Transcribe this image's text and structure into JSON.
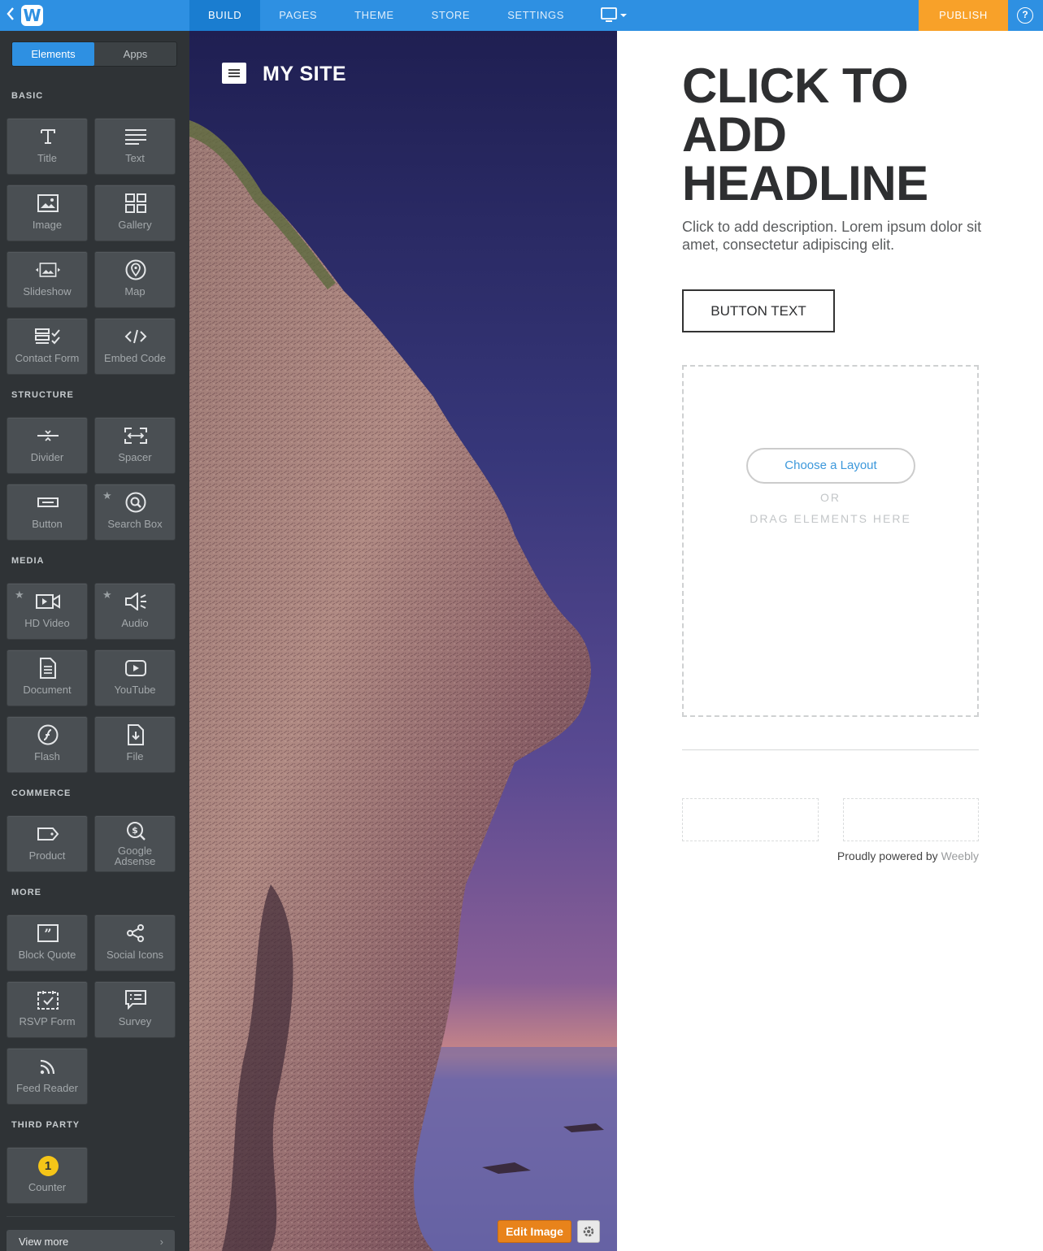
{
  "topbar": {
    "back_icon": "chevron-left-icon",
    "logo_letter": "W",
    "tabs": [
      "BUILD",
      "PAGES",
      "THEME",
      "STORE",
      "SETTINGS"
    ],
    "active_tab": "BUILD",
    "device_icon": "desktop-icon",
    "publish_label": "PUBLISH",
    "help_label": "?",
    "colors": {
      "bar": "#2e90e2",
      "active_tab": "#1a7dd0",
      "publish": "#f8a129"
    }
  },
  "sidebar": {
    "toggle": {
      "elements_label": "Elements",
      "apps_label": "Apps",
      "active": "Elements"
    },
    "categories": {
      "basic": "BASIC",
      "structure": "STRUCTURE",
      "media": "MEDIA",
      "commerce": "COMMERCE",
      "more": "MORE",
      "third_party": "THIRD PARTY"
    },
    "items": {
      "title": "Title",
      "text": "Text",
      "image": "Image",
      "gallery": "Gallery",
      "slideshow": "Slideshow",
      "map": "Map",
      "contact_form": "Contact Form",
      "embed_code": "Embed Code",
      "divider": "Divider",
      "spacer": "Spacer",
      "button": "Button",
      "search_box": "Search Box",
      "hd_video": "HD Video",
      "audio": "Audio",
      "document": "Document",
      "youtube": "YouTube",
      "flash": "Flash",
      "file": "File",
      "product": "Product",
      "google_adsense_1": "Google",
      "google_adsense_2": "Adsense",
      "block_quote": "Block Quote",
      "social_icons": "Social Icons",
      "rsvp_form": "RSVP Form",
      "survey": "Survey",
      "feed_reader": "Feed Reader",
      "counter": "Counter",
      "counter_badge": "1"
    },
    "view_more": "View more"
  },
  "canvas": {
    "site_title": "MY SITE",
    "edit_image_label": "Edit Image",
    "headline": "CLICK TO ADD HEADLINE",
    "description": "Click to add description. Lorem ipsum dolor sit amet, consectetur adipiscing elit.",
    "button_text": "BUTTON TEXT",
    "choose_layout": "Choose a Layout",
    "or_text": "OR",
    "drag_text": "DRAG ELEMENTS HERE",
    "powered_by": "Proudly powered by",
    "powered_brand": "Weebly"
  }
}
